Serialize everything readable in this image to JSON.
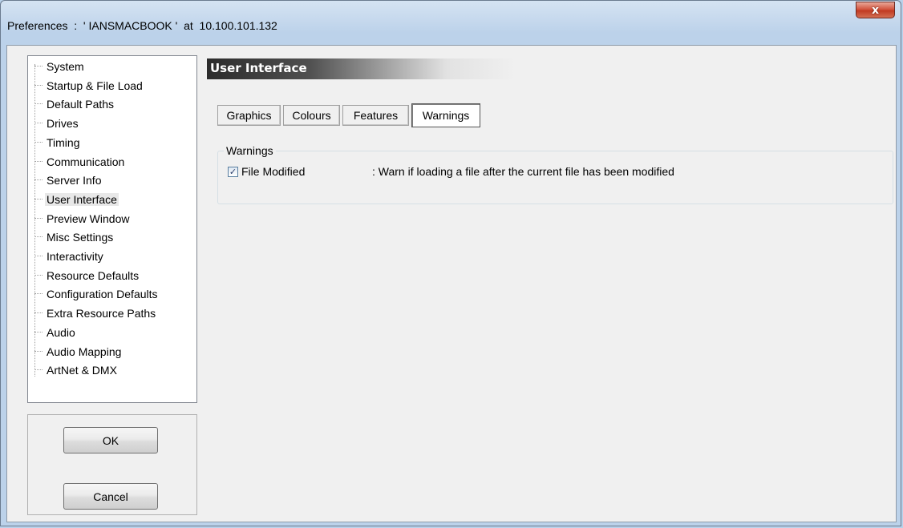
{
  "window": {
    "title": "Preferences  :  ' IANSMACBOOK '  at  10.100.101.132",
    "close_glyph": "x"
  },
  "tree": {
    "items": [
      {
        "label": "System"
      },
      {
        "label": "Startup & File Load"
      },
      {
        "label": "Default Paths"
      },
      {
        "label": "Drives"
      },
      {
        "label": "Timing"
      },
      {
        "label": "Communication"
      },
      {
        "label": "Server Info"
      },
      {
        "label": "User Interface",
        "selected": true
      },
      {
        "label": "Preview Window"
      },
      {
        "label": "Misc Settings"
      },
      {
        "label": "Interactivity"
      },
      {
        "label": "Resource Defaults"
      },
      {
        "label": "Configuration Defaults"
      },
      {
        "label": "Extra Resource Paths"
      },
      {
        "label": "Audio"
      },
      {
        "label": "Audio Mapping"
      },
      {
        "label": "ArtNet & DMX"
      }
    ]
  },
  "buttons": {
    "ok": "OK",
    "cancel": "Cancel"
  },
  "section": {
    "title": "User Interface"
  },
  "tabs": [
    {
      "label": "Graphics"
    },
    {
      "label": "Colours"
    },
    {
      "label": "Features"
    },
    {
      "label": "Warnings",
      "active": true
    }
  ],
  "warnings": {
    "group_label": "Warnings",
    "file_modified": {
      "label": "File Modified",
      "checked": true,
      "description": ": Warn if loading a file after the current file has been modified"
    }
  },
  "colors": {
    "close_button": "#c13b22",
    "title_bar": "#bcd2ea",
    "section_header_dark": "#2c2c2c"
  }
}
